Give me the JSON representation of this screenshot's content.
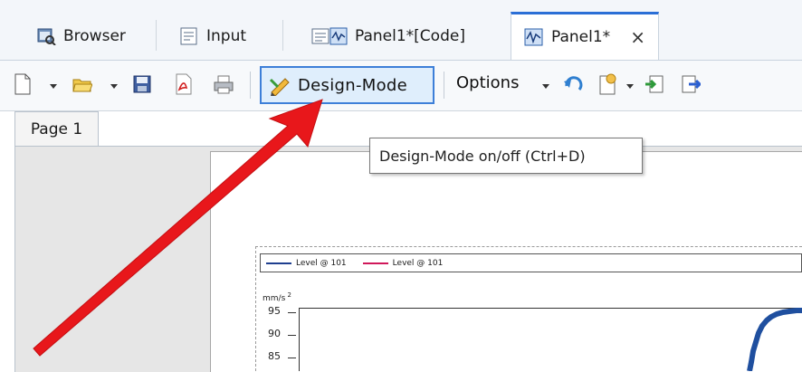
{
  "tabs": [
    {
      "label": "Browser",
      "icon": "browser-icon"
    },
    {
      "label": "Input",
      "icon": "input-form-icon"
    },
    {
      "label": "Panel1*[Code]",
      "icon": "code-panel-icon"
    },
    {
      "label": "Panel1*",
      "icon": "panel-icon",
      "active": true
    }
  ],
  "toolbar": {
    "design_mode_label": "Design-Mode",
    "options_label": "Options",
    "icons": [
      "new-page-icon",
      "open-folder-icon",
      "save-icon",
      "pdf-icon",
      "print-icon",
      "undo-icon",
      "page-menu-icon",
      "import-icon",
      "export-icon"
    ]
  },
  "tooltip": "Design-Mode on/off (Ctrl+D)",
  "page_tab": "Page 1",
  "chart_data": {
    "type": "line",
    "series": [
      {
        "name": "Level @ 101",
        "color": "#1f3f8f"
      },
      {
        "name": "Level @ 101",
        "color": "#d0185a"
      }
    ],
    "ylabel": "mm/s",
    "yticks": [
      95,
      90,
      85
    ],
    "grid": false,
    "legend_position": "top"
  },
  "colors": {
    "accent": "#2b6fd6",
    "design_button_bg": "#dfeefc",
    "arrow": "#e8171b"
  }
}
